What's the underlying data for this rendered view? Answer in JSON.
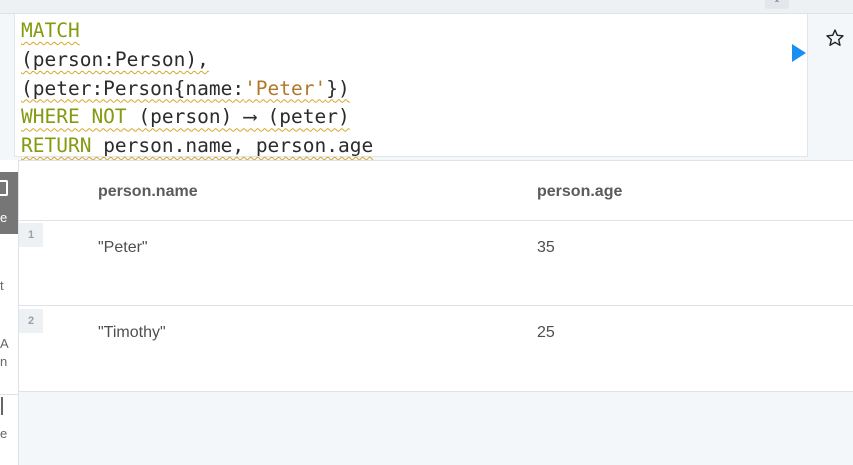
{
  "editor": {
    "lines": [
      [
        {
          "t": "MATCH",
          "c": "kw"
        }
      ],
      [
        {
          "t": "(person:Person),",
          "c": "plain"
        }
      ],
      [
        {
          "t": "(peter:Person{name:",
          "c": "plain"
        },
        {
          "t": "'Peter'",
          "c": "str"
        },
        {
          "t": "})",
          "c": "plain"
        }
      ],
      [
        {
          "t": "WHERE NOT",
          "c": "kw"
        },
        {
          "t": " (person) ⟶ (peter)",
          "c": "plain"
        }
      ],
      [
        {
          "t": "RETURN",
          "c": "kw"
        },
        {
          "t": " person.name, person.age",
          "c": "plain"
        }
      ]
    ]
  },
  "toolbar": {
    "run_icon": "play-icon",
    "favorite_icon": "star-icon"
  },
  "sidebar": {
    "fragments": [
      "e",
      "t",
      "A",
      "n",
      "e"
    ]
  },
  "results": {
    "columns": [
      "person.name",
      "person.age"
    ],
    "rows": [
      {
        "num": "1",
        "cells": [
          "\"Peter\"",
          "35"
        ]
      },
      {
        "num": "2",
        "cells": [
          "\"Timothy\"",
          "25"
        ]
      }
    ]
  },
  "colors": {
    "keyword": "#849a0f",
    "string": "#b0792a",
    "run": "#1a8ff1"
  }
}
